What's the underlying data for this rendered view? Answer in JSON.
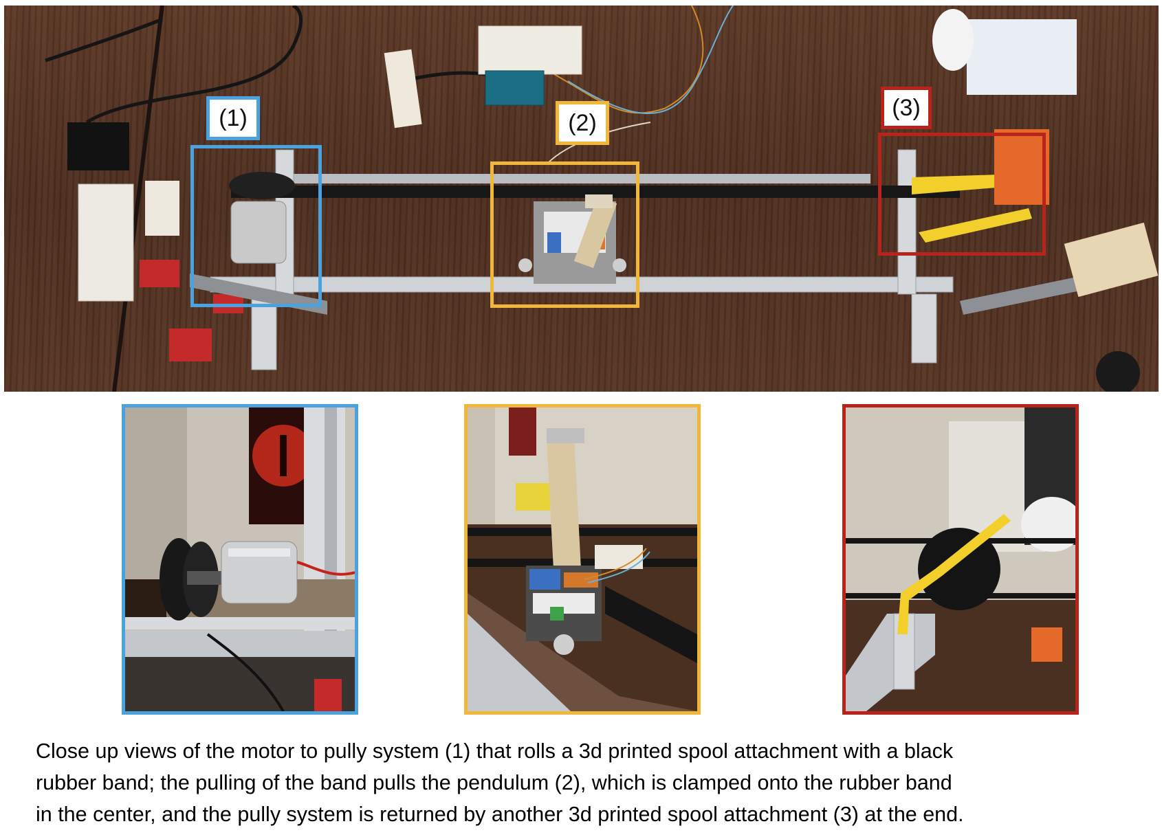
{
  "labels": {
    "motor": "(1)",
    "pendulum": "(2)",
    "spool_end": "(3)"
  },
  "colors": {
    "motor_box": "#4aa3df",
    "pendulum_box": "#f0b73a",
    "spool_end_box": "#b8241c",
    "table_wood": "#4a2d1f",
    "rail": "#c9ccd0",
    "band": "#1a1a1a",
    "lego_yellow": "#f2cf2a"
  },
  "caption": {
    "line1": "Close up views of the motor to pully system (1) that rolls a 3d printed spool attachment with a black",
    "line2": "rubber band; the pulling of the band pulls the pendulum (2), which is clamped onto the rubber band",
    "line3": "in the center, and the pully system is returned by another 3d printed spool attachment (3) at the end."
  }
}
